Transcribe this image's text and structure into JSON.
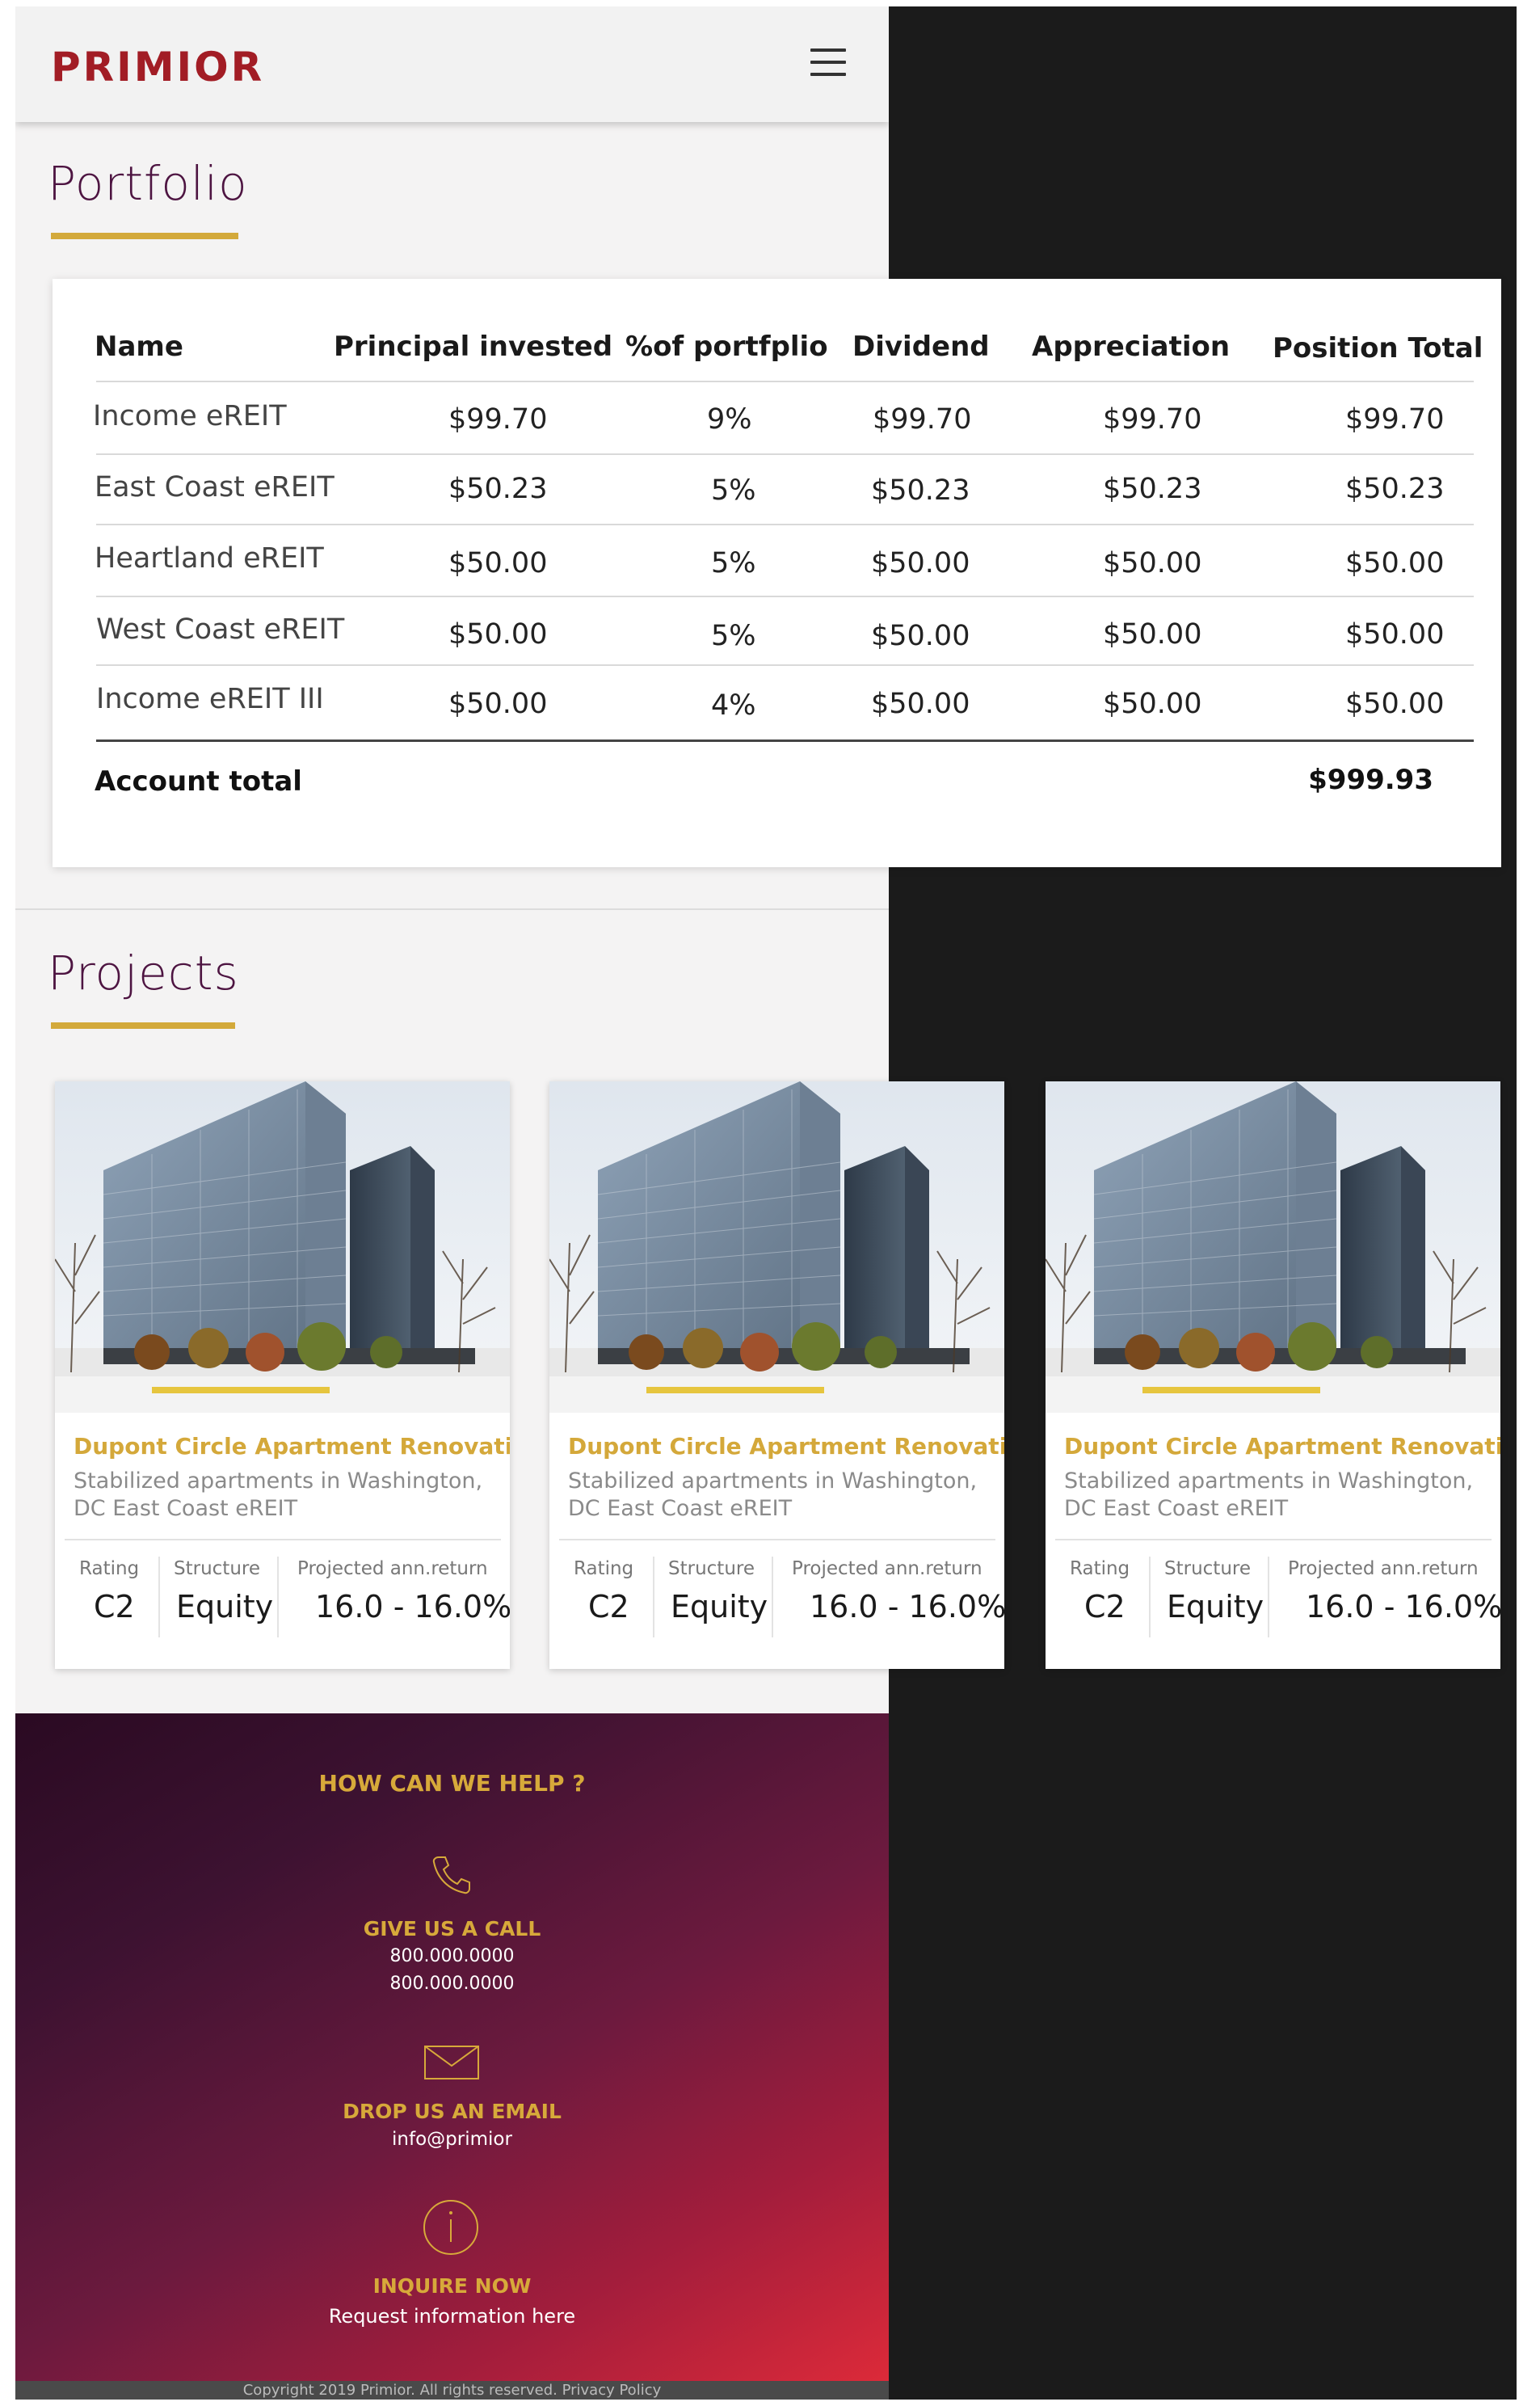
{
  "header": {
    "logo": "PRIMIOR",
    "menu_icon": "hamburger-menu-icon"
  },
  "portfolio": {
    "title": "Portfolio",
    "columns": [
      "Name",
      "Principal invested",
      "%of portfplio",
      "Dividend",
      "Appreciation",
      "Position Total"
    ],
    "rows": [
      {
        "name": "Income eREIT",
        "principal": "$99.70",
        "percent": "9%",
        "dividend": "$99.70",
        "appreciation": "$99.70",
        "total": "$99.70"
      },
      {
        "name": "East Coast eREIT",
        "principal": "$50.23",
        "percent": "5%",
        "dividend": "$50.23",
        "appreciation": "$50.23",
        "total": "$50.23"
      },
      {
        "name": "Heartland eREIT",
        "principal": "$50.00",
        "percent": "5%",
        "dividend": "$50.00",
        "appreciation": "$50.00",
        "total": "$50.00"
      },
      {
        "name": "West Coast eREIT",
        "principal": "$50.00",
        "percent": "5%",
        "dividend": "$50.00",
        "appreciation": "$50.00",
        "total": "$50.00"
      },
      {
        "name": "Income eREIT III",
        "principal": "$50.00",
        "percent": "4%",
        "dividend": "$50.00",
        "appreciation": "$50.00",
        "total": "$50.00"
      }
    ],
    "account_total_label": "Account total",
    "account_total_value": "$999.93"
  },
  "projects": {
    "title": "Projects",
    "cards": [
      {
        "title": "Dupont Circle Apartment Renovation",
        "description": "Stabilized apartments in Washington, DC East Coast eREIT",
        "rating_label": "Rating",
        "rating": "C2",
        "structure_label": "Structure",
        "structure": "Equity",
        "return_label": "Projected ann.return",
        "return": "16.0 - 16.0%"
      },
      {
        "title": "Dupont Circle Apartment Renovation",
        "description": "Stabilized apartments in Washington, DC East Coast eREIT",
        "rating_label": "Rating",
        "rating": "C2",
        "structure_label": "Structure",
        "structure": "Equity",
        "return_label": "Projected ann.return",
        "return": "16.0 - 16.0%"
      },
      {
        "title": "Dupont Circle Apartment Renovation",
        "description": "Stabilized apartments in Washington, DC East Coast eREIT",
        "rating_label": "Rating",
        "rating": "C2",
        "structure_label": "Structure",
        "structure": "Equity",
        "return_label": "Projected ann.return",
        "return": "16.0 - 16.0%"
      }
    ]
  },
  "footer": {
    "heading": "HOW CAN WE HELP ?",
    "call_title": "GIVE US A CALL",
    "phone_1": "800.000.0000",
    "phone_2": "800.000.0000",
    "email_title": "DROP US AN EMAIL",
    "email": "info@primior",
    "inquire_title": "INQUIRE NOW",
    "inquire_link": "Request information here",
    "copyright": "Copyright 2019 Primior. All rights reserved. Privacy Policy"
  },
  "colors": {
    "brand": "#a21d25",
    "accent_gold": "#d3a93a",
    "heading_purple": "#4d1441"
  }
}
